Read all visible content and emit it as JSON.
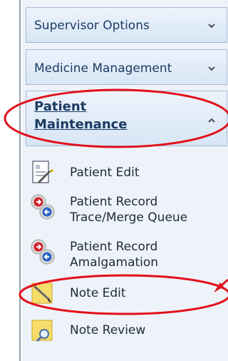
{
  "sections": {
    "supervisor": {
      "label": "Supervisor Options",
      "state": "collapsed"
    },
    "medicine": {
      "label": "Medicine Management",
      "state": "collapsed"
    },
    "patient": {
      "label_line1": "Patient",
      "label_line2": "Maintenance",
      "state": "expanded"
    }
  },
  "items": {
    "patient_edit": {
      "label": "Patient Edit",
      "icon": "patient-edit-icon"
    },
    "trace_merge": {
      "line1": "Patient Record",
      "line2": "Trace/Merge Queue",
      "icon": "record-arrows-icon"
    },
    "amalgamation": {
      "line1": "Patient Record",
      "line2": "Amalgamation",
      "icon": "record-arrows-icon"
    },
    "note_edit": {
      "label": "Note Edit",
      "icon": "note-pencil-icon"
    },
    "note_review": {
      "label": "Note Review",
      "icon": "note-magnifier-icon"
    }
  },
  "annotations": {
    "highlight_color": "#e3101a"
  }
}
